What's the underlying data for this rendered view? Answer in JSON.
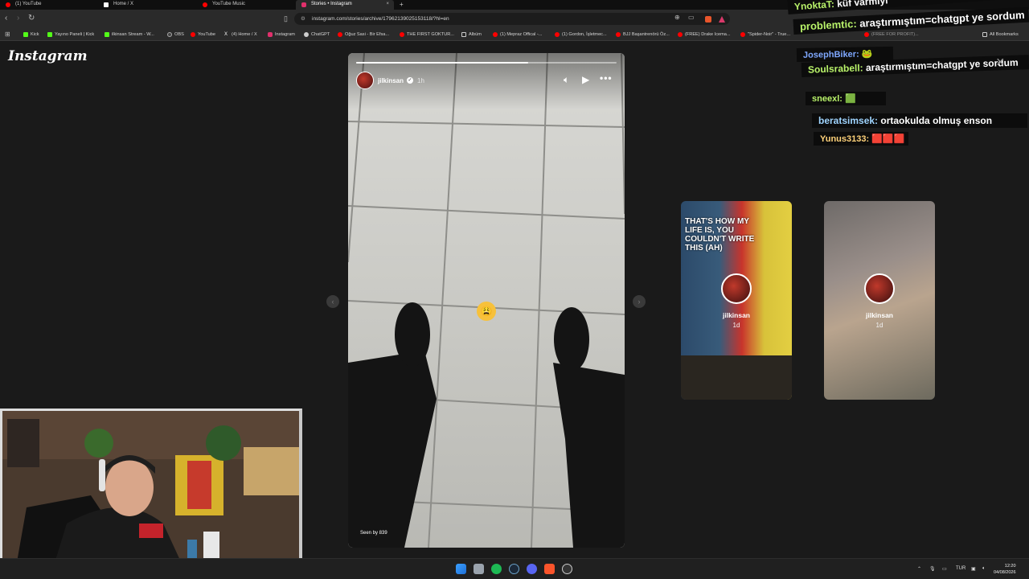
{
  "browser": {
    "tabs": [
      {
        "label": "(1) YouTube",
        "color": "#ff0000"
      },
      {
        "label": "Home / X",
        "color": "#ffffff"
      },
      {
        "label": "YouTube Music",
        "color": "#ff0000"
      },
      {
        "label": "Stories • Instagram",
        "color": "#e1306c"
      }
    ],
    "new_tab_label": "+",
    "close_label": "×",
    "url": "instagram.com/stories/archive/17962139025153118/?hl=en",
    "bookmarks": [
      {
        "label": "Kick",
        "kind": "kick",
        "color": "#53fc18"
      },
      {
        "label": "Yayıno Paneli | Kick",
        "kind": "kick",
        "color": "#53fc18"
      },
      {
        "label": "ilkinsan Stream - W...",
        "kind": "kick",
        "color": "#53fc18"
      },
      {
        "label": "OBS",
        "kind": "dot",
        "color": "#444444"
      },
      {
        "label": "YouTube",
        "kind": "dot",
        "color": "#ff0000"
      },
      {
        "label": "(4) Home / X",
        "kind": "x",
        "color": "#ffffff"
      },
      {
        "label": "Instagram",
        "kind": "dot",
        "color": "#e1306c"
      },
      {
        "label": "ChatGPT",
        "kind": "dot",
        "color": "#cccccc"
      },
      {
        "label": "Oğuz Sasi - Bir Efsa...",
        "kind": "dot",
        "color": "#ff0000"
      },
      {
        "label": "THE FIRST GOKTUR...",
        "kind": "dot",
        "color": "#ff0000"
      },
      {
        "label": "Albüm",
        "kind": "dot",
        "color": "#d6b33a"
      },
      {
        "label": "(1) Mepraz Offical -...",
        "kind": "dot",
        "color": "#ff0000"
      },
      {
        "label": "(1) Gordon, İşletmec...",
        "kind": "dot",
        "color": "#ff0000"
      },
      {
        "label": "BJJ Başantrenörü Öz...",
        "kind": "dot",
        "color": "#ff0000"
      },
      {
        "label": "(FREE) Drake Icema...",
        "kind": "dot",
        "color": "#ff0000"
      },
      {
        "label": "\"Spider-Noir\" - True...",
        "kind": "dot",
        "color": "#ff0000"
      }
    ],
    "bookmarks_overflow": "(FREE FOR PROFIT)...",
    "all_bookmarks": "All Bookmarks"
  },
  "instagram": {
    "logo": "Instagram",
    "story": {
      "username": "jilkinsan",
      "time": "1h",
      "progress": 0.66,
      "seen_by": "Seen by 839",
      "emoji": "😩"
    },
    "previews": [
      {
        "username": "jilkinsan",
        "time": "1d",
        "caption": "THAT'S HOW MY LIFE IS, YOU COULDN'T WRITE THIS (AH)"
      },
      {
        "username": "jilkinsan",
        "time": "1d"
      }
    ],
    "prev_arrow": "‹",
    "next_arrow": "›"
  },
  "chat": [
    {
      "user": "YnoktaT:",
      "msg": "küf varmıyı"
    },
    {
      "user": "problemtic:",
      "msg": "araştırmıştım=chatgpt ye sordum"
    },
    {
      "user": "JosephBiker:",
      "msg": "🐸"
    },
    {
      "user": "Soulsrabell:",
      "msg": "araştırmıştım=chatgpt ye sordum"
    },
    {
      "user": "sneexl:",
      "msg": "🟩"
    },
    {
      "user": "beratsimsek:",
      "msg": "ortaokulda olmuş enson"
    },
    {
      "user": "Yunus3133:",
      "msg": "🟥🟥🟥"
    }
  ],
  "chat_close": "×",
  "taskbar": {
    "tray_lang": "TUR",
    "time": "12:20",
    "date": "04/08/2026"
  }
}
